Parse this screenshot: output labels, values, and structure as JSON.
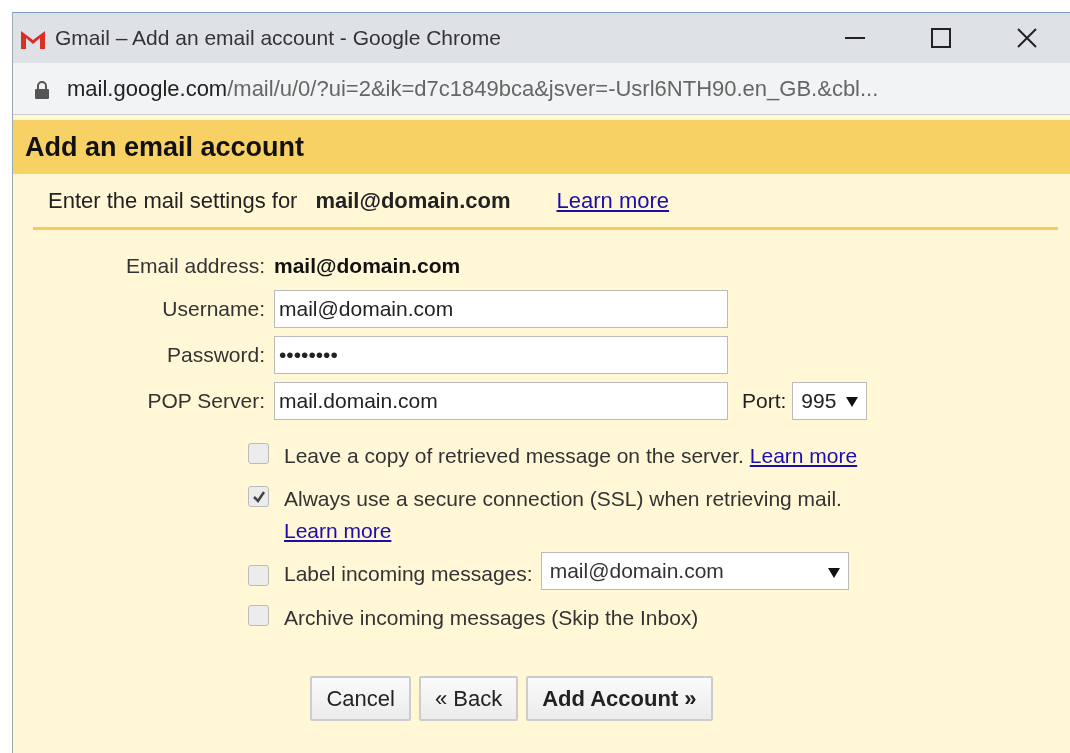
{
  "window": {
    "title": "Gmail – Add an email account - Google Chrome"
  },
  "address_bar": {
    "host": "mail.google.com",
    "path": "/mail/u/0/?ui=2&ik=d7c1849bca&jsver=-Usrl6NTH90.en_GB.&cbl..."
  },
  "dialog": {
    "title": "Add an email account",
    "intro": "Enter the mail settings for",
    "intro_email": "mail@domain.com",
    "intro_link": "Learn more"
  },
  "email_address": {
    "label": "Email address:",
    "value": "mail@domain.com"
  },
  "username": {
    "label": "Username:",
    "value": "mail@domain.com"
  },
  "password": {
    "label": "Password:",
    "value": "••••••••"
  },
  "pop_server": {
    "label": "POP Server:",
    "value": "mail.domain.com"
  },
  "port": {
    "label": "Port:",
    "value": "995"
  },
  "options": [
    {
      "text": "Leave a copy of retrieved message on the server.",
      "checked": false,
      "link": "Learn more"
    },
    {
      "text": "Always use a secure connection (SSL) when retrieving mail.",
      "checked": true,
      "link": "Learn more"
    },
    {
      "text": "Label incoming messages:",
      "checked": false,
      "select": "mail@domain.com"
    },
    {
      "text": "Archive incoming messages (Skip the Inbox)",
      "checked": false
    }
  ],
  "buttons": [
    {
      "label": "Cancel",
      "primary": false
    },
    {
      "label": "« Back",
      "primary": false
    },
    {
      "label": "Add Account »",
      "primary": true
    }
  ]
}
